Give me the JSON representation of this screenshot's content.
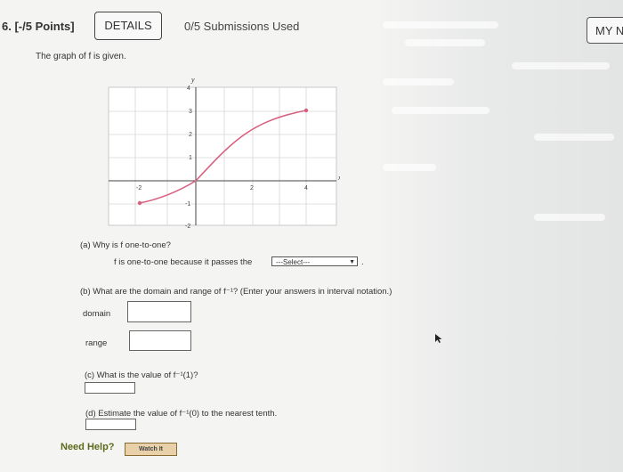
{
  "header": {
    "question_number": "6. [-/5 Points]",
    "details_label": "DETAILS",
    "submissions": "0/5 Submissions Used",
    "account_label": "MY N"
  },
  "problem": {
    "prompt": "The graph of f is given.",
    "graph": {
      "x_axis_label": "x",
      "y_axis_label": "y",
      "x_tick_labels": [
        "-2",
        "2",
        "4"
      ],
      "y_tick_labels": [
        "4",
        "3",
        "2",
        "1",
        "-1",
        "-2"
      ],
      "curve_color": "#d75f7f",
      "curve_start": [
        -2,
        -0.8
      ],
      "curve_end": [
        4,
        2.6
      ],
      "passes_through": [
        0,
        0
      ]
    },
    "part_a": {
      "question": "(a) Why is f one-to-one?",
      "answer_prefix": "f is one-to-one because it passes the",
      "select_value": "---Select---",
      "select_suffix": "."
    },
    "part_b": {
      "question": "(b) What are the domain and range of f⁻¹? (Enter your answers in interval notation.)",
      "domain_label": "domain",
      "range_label": "range",
      "domain_value": "",
      "range_value": ""
    },
    "part_c": {
      "question": "(c) What is the value of f⁻¹(1)?",
      "value": ""
    },
    "part_d": {
      "question": "(d) Estimate the value of f⁻¹(0) to the nearest tenth.",
      "value": ""
    }
  },
  "help": {
    "need_help_label": "Need Help?",
    "watch_label": "Watch It"
  }
}
